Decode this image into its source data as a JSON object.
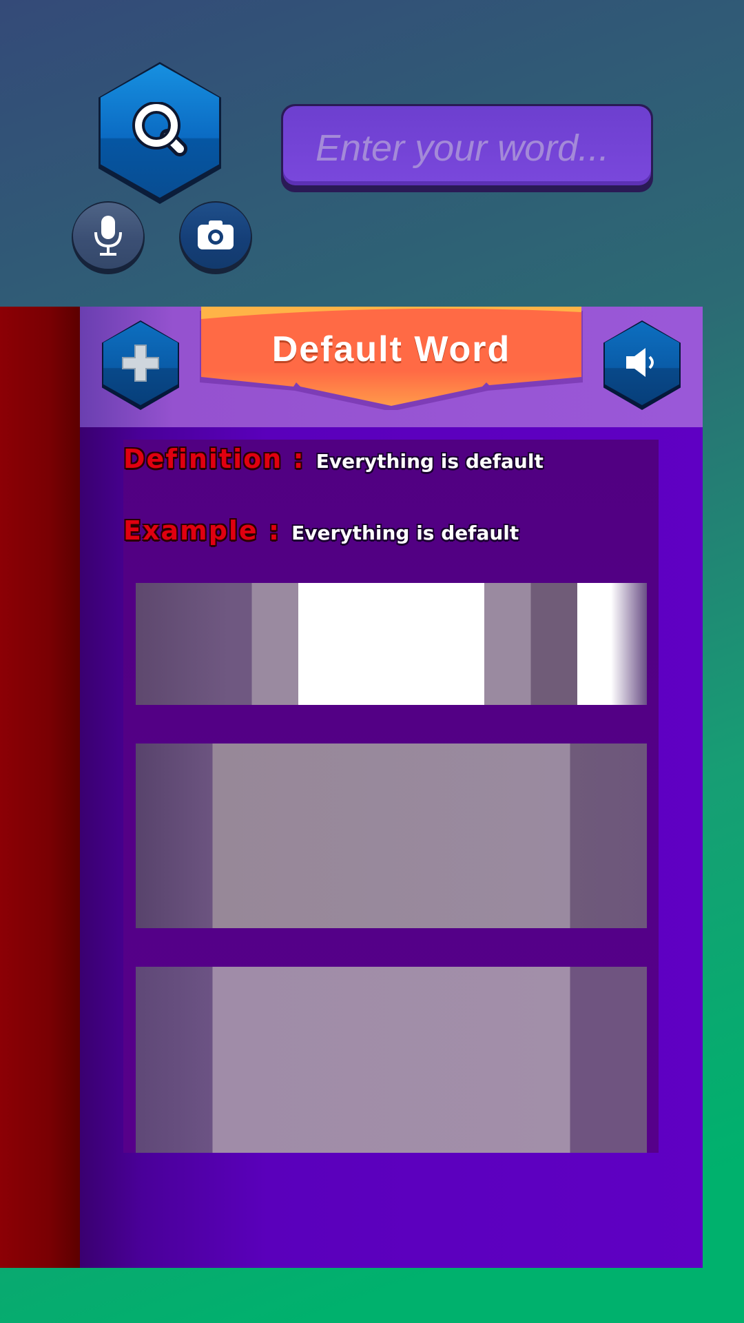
{
  "search": {
    "placeholder": "Enter your word..."
  },
  "buttons": {
    "search_icon": "magnifier-icon",
    "mic_icon": "microphone-icon",
    "camera_icon": "camera-icon",
    "add_icon": "plus-icon",
    "sound_icon": "speaker-icon"
  },
  "word_card": {
    "title": "Default Word",
    "definition_label": "Definition :",
    "definition_value": "Everything is default",
    "example_label": "Example :",
    "example_value": "Everything is default"
  },
  "colors": {
    "accent_purple": "#7a48dc",
    "banner_orange": "#ff6a45",
    "label_red": "#e00010",
    "button_blue": "#0b6bc3"
  }
}
